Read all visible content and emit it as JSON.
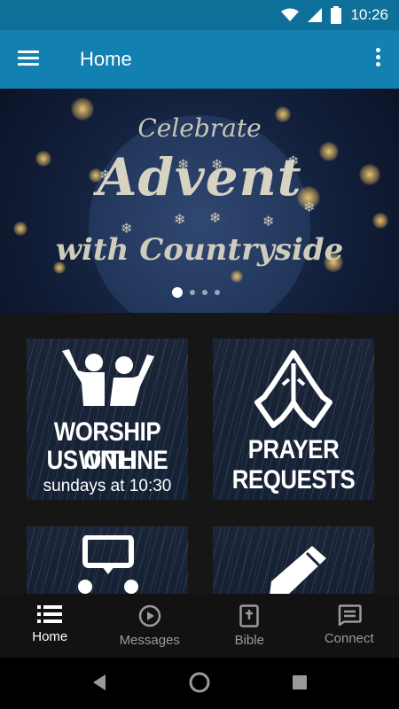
{
  "status_bar": {
    "time": "10:26"
  },
  "app_bar": {
    "title": "Home"
  },
  "banner": {
    "line1": "Celebrate",
    "line2": "Advent",
    "line3": "with Countryside",
    "slide_count": 4,
    "active_slide": 1
  },
  "tiles": [
    {
      "title_line1": "WORSHIP WITH",
      "title_line2": "US ONLINE",
      "subtitle": "sundays at 10:30",
      "icon": "people-raising-hands-icon"
    },
    {
      "title_line1": "PRAYER",
      "title_line2": "REQUESTS",
      "icon": "praying-hands-icon"
    },
    {
      "icon": "connection-chat-icon"
    },
    {
      "icon": "pencil-icon"
    }
  ],
  "bottom_nav": [
    {
      "label": "Home",
      "icon": "list-icon",
      "active": true
    },
    {
      "label": "Messages",
      "icon": "play-circle-icon",
      "active": false
    },
    {
      "label": "Bible",
      "icon": "bible-icon",
      "active": false
    },
    {
      "label": "Connect",
      "icon": "message-box-icon",
      "active": false
    }
  ],
  "colors": {
    "status_bar": "#0e6f98",
    "app_bar": "#1380b2",
    "background": "#161616",
    "nav_active": "#ffffff",
    "nav_inactive": "#9a9a9a"
  }
}
